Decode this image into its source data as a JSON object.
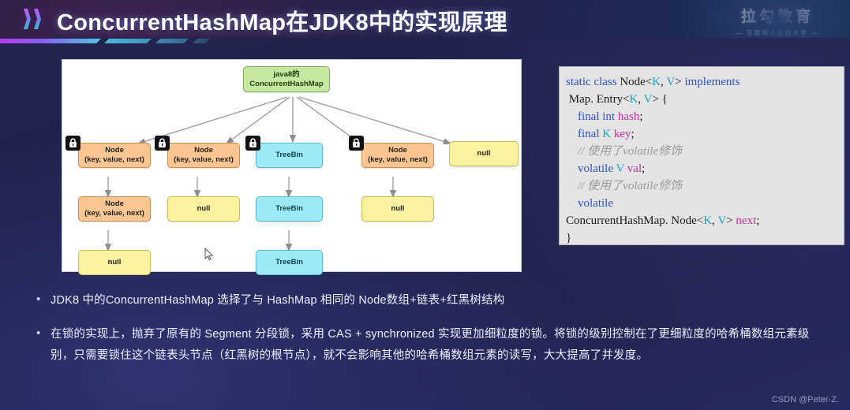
{
  "header": {
    "title": "ConcurrentHashMap在JDK8中的实现原理",
    "logo_main": "拉勾教育",
    "logo_sub": "— 互联网人实战大学 —",
    "chevron_icon": "double-chevron-right-icon"
  },
  "diagram": {
    "root_line1": "java8的",
    "root_line2": "ConcurrentHashMap",
    "node_line1": "Node",
    "node_line2": "(key, value, next)",
    "treebin": "TreeBin",
    "null": "null",
    "lock_icon": "padlock-icon",
    "cursor_icon": "mouse-pointer-icon",
    "columns": [
      {
        "locked": true,
        "cells": [
          "node",
          "node",
          "null"
        ]
      },
      {
        "locked": true,
        "cells": [
          "node",
          "null"
        ]
      },
      {
        "locked": true,
        "cells": [
          "tree",
          "tree",
          "tree"
        ]
      },
      {
        "locked": true,
        "cells": [
          "node",
          "null"
        ]
      },
      {
        "locked": false,
        "cells": [
          "null"
        ]
      }
    ]
  },
  "code": {
    "lines": [
      [
        {
          "t": "static ",
          "c": "kw"
        },
        {
          "t": "class ",
          "c": "kw"
        },
        {
          "t": "Node",
          "c": "pl"
        },
        {
          "t": "<",
          "c": "pl"
        },
        {
          "t": "K",
          "c": "gen"
        },
        {
          "t": ", ",
          "c": "pl"
        },
        {
          "t": "V",
          "c": "gen"
        },
        {
          "t": "> ",
          "c": "pl"
        },
        {
          "t": "implements",
          "c": "kw"
        }
      ],
      [
        {
          "t": " Map. Entry",
          "c": "pl"
        },
        {
          "t": "<",
          "c": "pl"
        },
        {
          "t": "K",
          "c": "gen"
        },
        {
          "t": ", ",
          "c": "pl"
        },
        {
          "t": "V",
          "c": "gen"
        },
        {
          "t": "> {",
          "c": "pl"
        }
      ],
      [
        {
          "t": "    ",
          "c": "pl"
        },
        {
          "t": "final ",
          "c": "kw"
        },
        {
          "t": "int ",
          "c": "kw"
        },
        {
          "t": "hash",
          "c": "id"
        },
        {
          "t": ";",
          "c": "pl"
        }
      ],
      [
        {
          "t": "    ",
          "c": "pl"
        },
        {
          "t": "final ",
          "c": "kw"
        },
        {
          "t": "K ",
          "c": "gen"
        },
        {
          "t": "key",
          "c": "id"
        },
        {
          "t": ";",
          "c": "pl"
        }
      ],
      [
        {
          "t": "    // 使用了volatile修饰",
          "c": "cm"
        }
      ],
      [
        {
          "t": "    ",
          "c": "pl"
        },
        {
          "t": "volatile ",
          "c": "kw"
        },
        {
          "t": "V ",
          "c": "gen"
        },
        {
          "t": "val",
          "c": "id"
        },
        {
          "t": ";",
          "c": "pl"
        }
      ],
      [
        {
          "t": "    // 使用了volatile修饰",
          "c": "cm"
        }
      ],
      [
        {
          "t": "    ",
          "c": "pl"
        },
        {
          "t": "volatile",
          "c": "kw"
        }
      ],
      [
        {
          "t": "ConcurrentHashMap. Node",
          "c": "pl"
        },
        {
          "t": "<",
          "c": "pl"
        },
        {
          "t": "K",
          "c": "gen"
        },
        {
          "t": ", ",
          "c": "pl"
        },
        {
          "t": "V",
          "c": "gen"
        },
        {
          "t": "> ",
          "c": "pl"
        },
        {
          "t": "next",
          "c": "id"
        },
        {
          "t": ";",
          "c": "pl"
        }
      ],
      [
        {
          "t": "}",
          "c": "pl"
        }
      ]
    ]
  },
  "bullets": {
    "marker": "•",
    "items": [
      "JDK8 中的ConcurrentHashMap 选择了与 HashMap 相同的 Node数组+链表+红黑树结构",
      "在锁的实现上，抛弃了原有的 Segment 分段锁，采用 CAS + synchronized 实现更加细粒度的锁。将锁的级别控制在了更细粒度的哈希桶数组元素级别，只需要锁住这个链表头节点（红黑树的根节点），就不会影响其他的哈希桶数组元素的读写，大大提高了并发度。"
    ]
  },
  "watermark": "CSDN @Peter-Z.",
  "colors": {
    "accent_magenta": "#b93cf0",
    "accent_cyan": "#4fc8e6",
    "node_fill": "#fbc592",
    "tree_fill": "#9bebf7",
    "null_fill": "#fbf2a0",
    "root_fill": "#c6e8a0",
    "slide_bg": "#23254f"
  }
}
